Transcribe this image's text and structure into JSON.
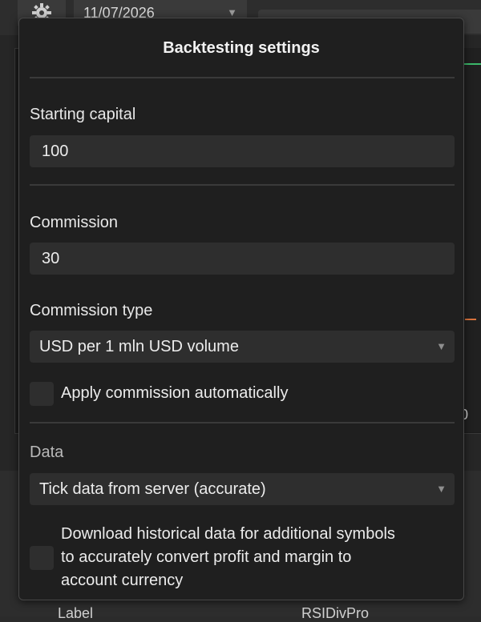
{
  "background": {
    "date_value": "11/07/2026",
    "axis_value": "0",
    "bottom_label": "Label",
    "bottom_value": "RSIDivPro"
  },
  "dialog": {
    "title": "Backtesting settings",
    "starting_capital": {
      "label": "Starting capital",
      "value": "100"
    },
    "commission": {
      "label": "Commission",
      "value": "30"
    },
    "commission_type": {
      "label": "Commission type",
      "selected": "USD per 1 mln USD volume"
    },
    "apply_commission": {
      "label": "Apply commission automatically",
      "checked": false
    },
    "data": {
      "label": "Data",
      "selected": "Tick data from server (accurate)"
    },
    "download_historical": {
      "label_lines": [
        "Download historical data for additional symbols",
        "to accurately convert profit and margin to",
        "account currency"
      ],
      "checked": false
    }
  },
  "icons": {
    "settings": "gear-icon",
    "dropdown": "chevron-down-icon"
  },
  "colors": {
    "dialog_bg": "#1f1f1f",
    "field_bg": "#2e2e2e",
    "accent_green": "#3bb86a",
    "accent_orange": "#d9733d"
  }
}
